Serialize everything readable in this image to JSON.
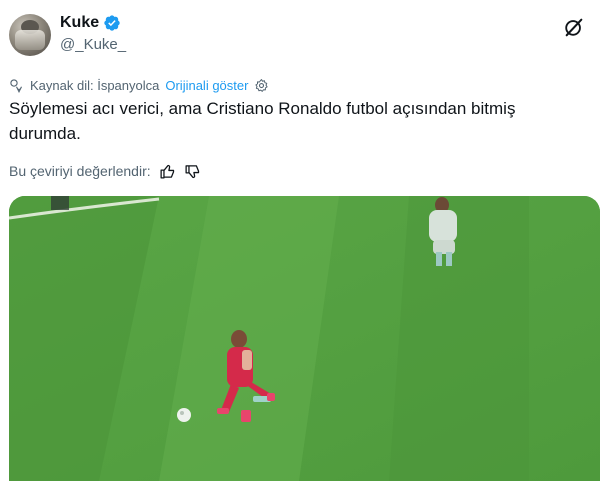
{
  "author": {
    "display_name": "Kuke",
    "handle": "@_Kuke_",
    "verified": true,
    "avatar_icon": "avatar-photo"
  },
  "translation": {
    "source_label": "Kaynak dil: İspanyolca",
    "show_original": "Orijinali göster",
    "icons": [
      "translate-icon",
      "gear-icon"
    ]
  },
  "tweet": {
    "text": "Söylemesi acı verici, ama Cristiano Ronaldo futbol açısından bitmiş durumda."
  },
  "rating": {
    "label": "Bu çeviriyi değerlendir:",
    "icons": [
      "thumbs-up-icon",
      "thumbs-down-icon"
    ]
  },
  "media": {
    "type": "video-frame",
    "description_icon": "football-pitch-image"
  },
  "colors": {
    "accent": "#1d9bf0",
    "text": "#0f1419",
    "muted": "#536471",
    "pitch": "#4f9a3b",
    "pitch_light": "#5ba844",
    "player_kit": "#d42a4a"
  }
}
